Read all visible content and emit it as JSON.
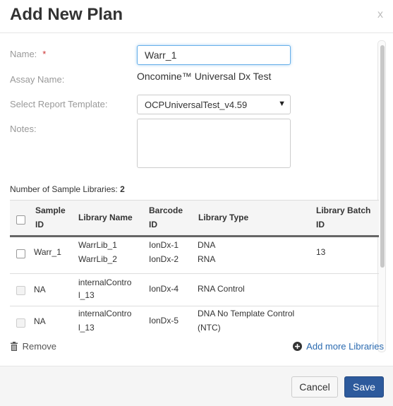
{
  "modal": {
    "title": "Add New Plan",
    "close_label": "x"
  },
  "form": {
    "name_label": "Name:",
    "required_mark": "*",
    "name_value": "Warr_1",
    "assay_label": "Assay Name:",
    "assay_value": "Oncomine™ Universal Dx Test",
    "template_label": "Select Report Template:",
    "template_value": "OCPUniversalTest_v4.59",
    "notes_label": "Notes:",
    "notes_value": ""
  },
  "libraries": {
    "count_label": "Number of Sample Libraries:",
    "count_value": "2",
    "columns": [
      "Sample ID",
      "Library Name",
      "Barcode ID",
      "Library Type",
      "Library Batch ID"
    ],
    "rows": [
      {
        "sample_id": "Warr_1",
        "library_name_1": "WarrLib_1",
        "library_name_2": "WarrLib_2",
        "barcode_1": "IonDx-1",
        "barcode_2": "IonDx-2",
        "type_1": "DNA",
        "type_2": "RNA",
        "batch_id": "13"
      },
      {
        "sample_id": "NA",
        "library_name_1": "internalContro",
        "library_name_2": "l_13",
        "barcode_1": "IonDx-4",
        "type_1": "RNA Control",
        "batch_id": ""
      },
      {
        "sample_id": "NA",
        "library_name_1": "internalContro",
        "library_name_2": "l_13",
        "barcode_1": "IonDx-5",
        "type_1": "DNA No Template Control",
        "type_2": "(NTC)",
        "batch_id": ""
      }
    ]
  },
  "actions": {
    "remove_label": "Remove",
    "add_more_label": "Add more Libraries",
    "cancel_label": "Cancel",
    "save_label": "Save"
  },
  "colors": {
    "primary": "#2d5a9c",
    "link": "#2a6ab0",
    "required": "#cc3333"
  }
}
